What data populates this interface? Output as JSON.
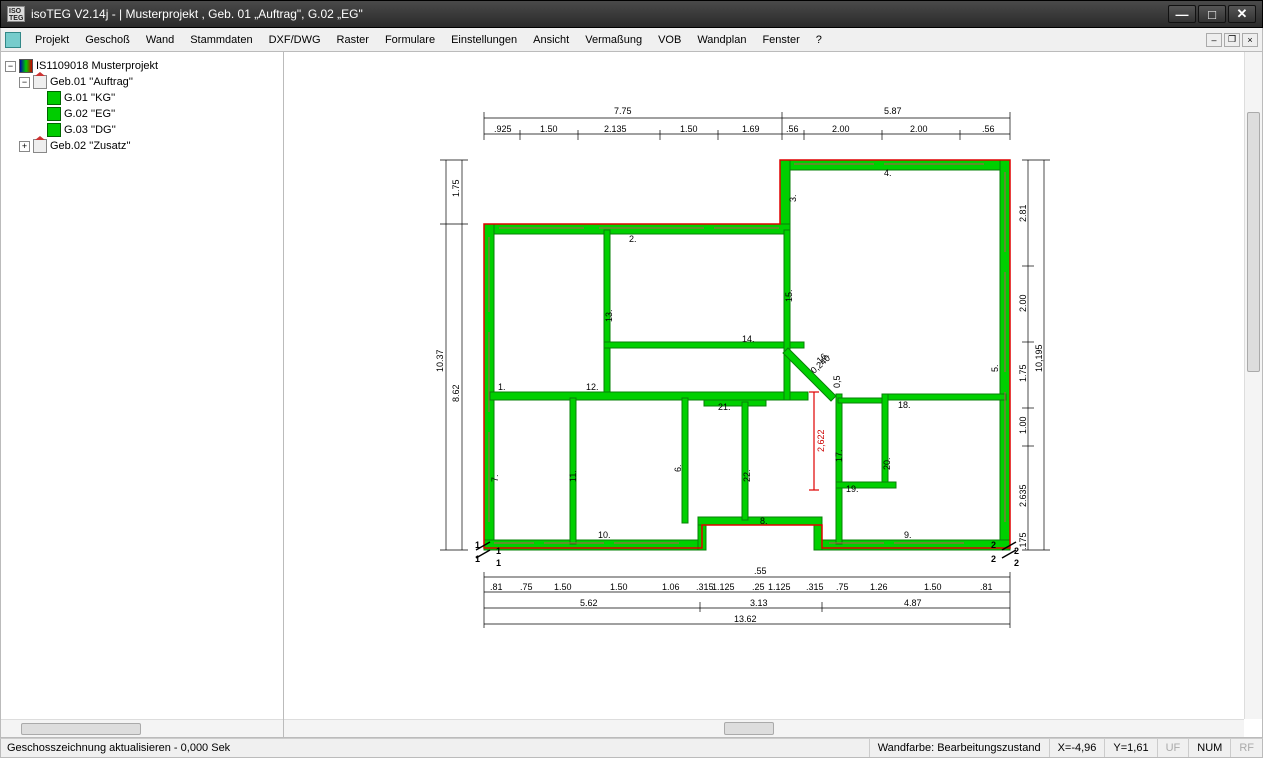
{
  "window": {
    "title": "isoTEG V2.14j - |  Musterprojekt , Geb. 01 „Auftrag\", G.02 „EG\""
  },
  "titlebar_icon": "ISO TEG",
  "menu": [
    "Projekt",
    "Geschoß",
    "Wand",
    "Stammdaten",
    "DXF/DWG",
    "Raster",
    "Formulare",
    "Einstellungen",
    "Ansicht",
    "Vermaßung",
    "VOB",
    "Wandplan",
    "Fenster",
    "?"
  ],
  "tree": {
    "root": "IS1109018  Musterprojekt",
    "b1": "Geb.01 ''Auftrag''",
    "f1": "G.01 ''KG''",
    "f2": "G.02 ''EG''",
    "f3": "G.03 ''DG''",
    "b2": "Geb.02 ''Zusatz''"
  },
  "status": {
    "left": "Geschosszeichnung aktualisieren - 0,000 Sek",
    "wandfarbe": "Wandfarbe: Bearbeitungszustand",
    "x": "X=-4,96",
    "y": "Y=1,61",
    "uf": "UF",
    "num": "NUM",
    "rf": "RF"
  },
  "dims_top": {
    "group1_total": "7.75",
    "group2_total": "5.87",
    "row": [
      ".925",
      "1.50",
      "2.135",
      "1.50",
      "1.69",
      ".56",
      "2.00",
      "2.00",
      ".56"
    ]
  },
  "dims_bottom": {
    "mid": ".55",
    "row": [
      ".81",
      ".75",
      "1.50",
      "1.50",
      "1.06",
      ".315",
      "1.125",
      ".25",
      "1.125",
      ".315",
      ".75",
      "1.26",
      "1.50",
      ".81"
    ],
    "group": [
      "5.62",
      "3.13",
      "4.87"
    ],
    "total": "13.62"
  },
  "dims_left": {
    "a": "1.75",
    "b": "8.62",
    "total": "10.37"
  },
  "dims_right": {
    "vals": [
      "2.81",
      "2.00",
      "1.75",
      "1.00",
      "2.635"
    ],
    "total": "10,195",
    "bot": ".175"
  },
  "wall_labels": [
    "1.",
    "2.",
    "3.",
    "4.",
    "5.",
    "6.",
    "7.",
    "8.",
    "9.",
    "10.",
    "11.",
    "12.",
    "13.",
    "14.",
    "15.",
    "16.",
    "17.",
    "18.",
    "19.",
    "20.",
    "21.",
    "22."
  ],
  "diag_dims": [
    "0,240",
    "0,5"
  ],
  "red_measure": "2,622",
  "corner_marks": {
    "bl": "1",
    "br": "2"
  }
}
